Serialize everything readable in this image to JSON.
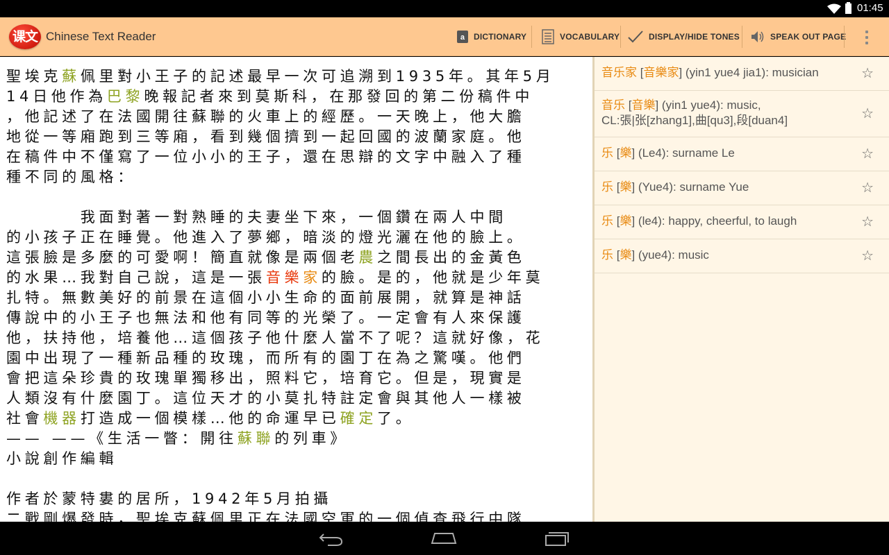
{
  "status": {
    "time": "01:45"
  },
  "app": {
    "logo_text": "课文",
    "title": "Chinese Text Reader"
  },
  "actions": [
    {
      "label": "DICTIONARY",
      "icon": "dictionary-icon"
    },
    {
      "label": "VOCABULARY",
      "icon": "vocabulary-icon"
    },
    {
      "label": "DISPLAY/HIDE TONES",
      "icon": "checkmark-icon"
    },
    {
      "label": "SPEAK OUT PAGE",
      "icon": "speaker-icon"
    }
  ],
  "colors": {
    "actionbar": "#fec890",
    "highlight_green": "#8ea322",
    "highlight_red": "#e8380c",
    "highlight_orange": "#e88a12",
    "definitions_bg": "#fff6e6"
  },
  "reader": {
    "lines": [
      [
        {
          "t": "聖埃克"
        },
        {
          "t": "蘇",
          "c": "g"
        },
        {
          "t": "佩里對小王子的記述最早一次可追溯到1935年。其年5月"
        }
      ],
      [
        {
          "t": "14日他作為"
        },
        {
          "t": "巴黎",
          "c": "g"
        },
        {
          "t": "晚報記者來到莫斯科，在那發回的第二份稿件中"
        }
      ],
      [
        {
          "t": "，他記述了在法國開往蘇聯的火車上的經歷。一天晚上，他大膽"
        }
      ],
      [
        {
          "t": "地從一等廂跑到三等廂，看到幾個擠到一起回國的波蘭家庭。他"
        }
      ],
      [
        {
          "t": "在稿件中不僅寫了一位小小的王子，還在思辯的文字中融入了種"
        }
      ],
      [
        {
          "t": "種不同的風格："
        }
      ],
      [
        {
          "t": ""
        }
      ],
      [
        {
          "t": "　　　　我面對著一對熟睡的夫妻坐下來，一個鑽在兩人中間"
        }
      ],
      [
        {
          "t": "的小孩子正在睡覺。他進入了夢鄉，暗淡的燈光灑在他的臉上。"
        }
      ],
      [
        {
          "t": "這張臉是多麼的可愛啊！簡直就像是兩個老"
        },
        {
          "t": "農",
          "c": "g"
        },
        {
          "t": "之間長出的金黃色"
        }
      ],
      [
        {
          "t": "的水果…我對自己說，這是一張"
        },
        {
          "t": "音",
          "c": "r"
        },
        {
          "t": "樂",
          "c": "r"
        },
        {
          "t": "家",
          "c": "o"
        },
        {
          "t": "的臉。是的，他就是少年莫"
        }
      ],
      [
        {
          "t": "扎特。無數美好的前景在這個小小生命的面前展開，就算是神話"
        }
      ],
      [
        {
          "t": "傳說中的小王子也無法和他有同等的光榮了。一定會有人來保護"
        }
      ],
      [
        {
          "t": "他，扶持他，培養他…這個孩子他什麼人當不了呢？這就好像，花"
        }
      ],
      [
        {
          "t": "園中出現了一種新品種的玫瑰，而所有的園丁在為之驚嘆。他們"
        }
      ],
      [
        {
          "t": "會把這朵珍貴的玫瑰單獨移出，照料它，培育它。但是，現實是"
        }
      ],
      [
        {
          "t": "人類沒有什麼園丁。這位天才的小莫扎特註定會與其他人一樣被"
        }
      ],
      [
        {
          "t": "社會"
        },
        {
          "t": "機器",
          "c": "g"
        },
        {
          "t": "打造成一個模樣…他的命運早已"
        },
        {
          "t": "確定",
          "c": "g"
        },
        {
          "t": "了。"
        }
      ],
      [
        {
          "t": "—— ——《生活一瞥：開往"
        },
        {
          "t": "蘇聯",
          "c": "g"
        },
        {
          "t": "的列車》"
        }
      ],
      [
        {
          "t": "小說創作編輯"
        }
      ],
      [
        {
          "t": ""
        }
      ],
      [
        {
          "t": "作者於蒙特婁的居所，1942年5月拍攝"
        }
      ],
      [
        {
          "t": "二戰剛爆發時，聖埃克蘇佩里正在法國空軍的一個偵查飛行中隊"
        }
      ]
    ]
  },
  "definitions": [
    {
      "simplified": "音乐家",
      "traditional": "音樂家",
      "gloss": "(yin1 yue4 jia1): musician",
      "gloss2": ""
    },
    {
      "simplified": "音乐",
      "traditional": "音樂",
      "gloss": "(yin1 yue4): music,",
      "gloss2": "CL:張|张[zhang1],曲[qu3],段[duan4]"
    },
    {
      "simplified": "乐",
      "traditional": "樂",
      "gloss": "(Le4): surname Le",
      "gloss2": ""
    },
    {
      "simplified": "乐",
      "traditional": "樂",
      "gloss": "(Yue4): surname Yue",
      "gloss2": ""
    },
    {
      "simplified": "乐",
      "traditional": "樂",
      "gloss": "(le4): happy, cheerful, to laugh",
      "gloss2": ""
    },
    {
      "simplified": "乐",
      "traditional": "樂",
      "gloss": "(yue4): music",
      "gloss2": ""
    }
  ],
  "nav": {
    "back": "back-icon",
    "home": "home-icon",
    "recents": "recents-icon"
  }
}
